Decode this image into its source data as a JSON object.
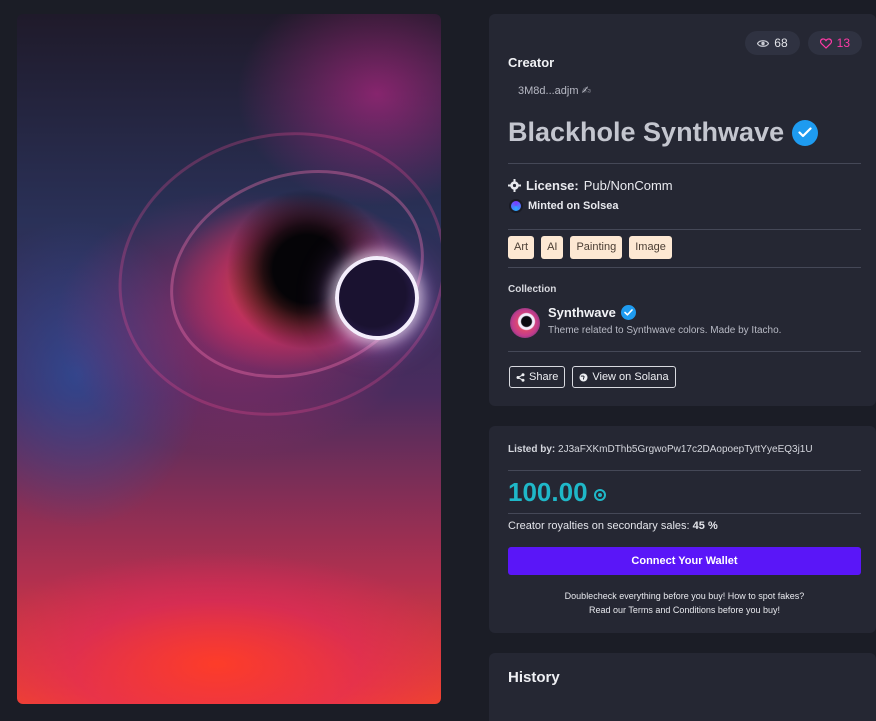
{
  "stats": {
    "views": "68",
    "likes": "13"
  },
  "creator": {
    "label": "Creator",
    "address": "3M8d...adjm ✍"
  },
  "nft": {
    "title": "Blackhole Synthwave"
  },
  "license": {
    "label": "License:",
    "value": "Pub/NonComm"
  },
  "minted": {
    "text": "Minted on Solsea"
  },
  "tags": [
    "Art",
    "AI",
    "Painting",
    "Image"
  ],
  "collection": {
    "label": "Collection",
    "name": "Synthwave",
    "description": "Theme related to Synthwave colors. Made by Itacho."
  },
  "actions": {
    "share": "Share",
    "view": "View on Solana"
  },
  "listing": {
    "listed_label": "Listed by:",
    "listed_address": "2J3aFXKmDThb5GrgwoPw17c2DAopoepTyttYyeEQ3j1U",
    "price": "100.00",
    "royalties_label": "Creator royalties on secondary sales:",
    "royalties_value": "45 %",
    "connect_label": "Connect Your Wallet",
    "note_line1": "Doublecheck everything before you buy! How to spot fakes?",
    "note_line2": "Read our Terms and Conditions before you buy!"
  },
  "history": {
    "title": "History"
  },
  "colors": {
    "accent": "#5a16f8",
    "price": "#1fb8c8",
    "verified": "#1e9bf0",
    "likes": "#ff3aa6",
    "tag_bg": "#fde8d3"
  }
}
